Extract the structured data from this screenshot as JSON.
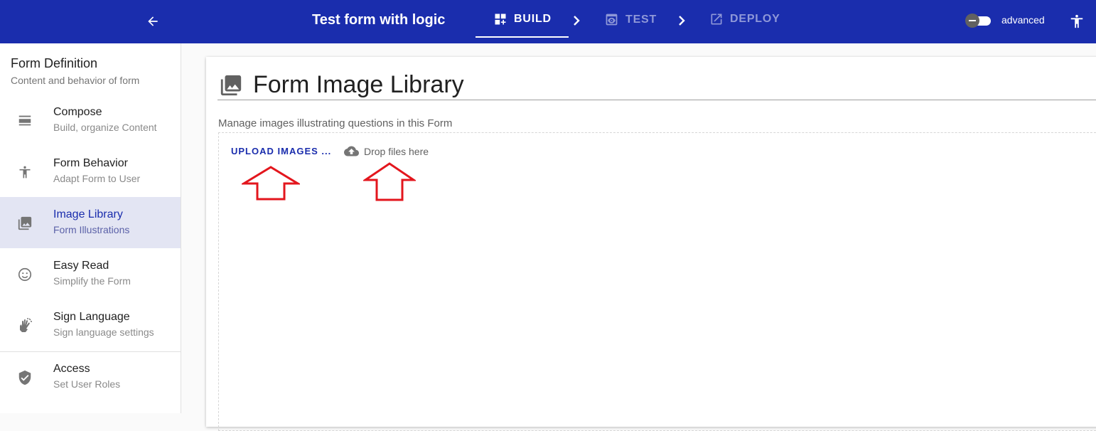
{
  "header": {
    "title": "Test form with logic",
    "steps": [
      {
        "label": "BUILD",
        "icon": "dashboard-customize-icon",
        "active": true
      },
      {
        "label": "TEST",
        "icon": "preview-eye-icon",
        "active": false
      },
      {
        "label": "DEPLOY",
        "icon": "open-in-new-icon",
        "active": false
      }
    ],
    "advanced_label": "advanced",
    "advanced_enabled": false,
    "colors": {
      "bar": "#1a2dad",
      "inactive_step": "#8f98d8"
    }
  },
  "sidebar": {
    "title": "Form Definition",
    "subtitle": "Content and behavior of form",
    "items": [
      {
        "label": "Compose",
        "sub": "Build, organize Content",
        "icon": "view-agenda-icon"
      },
      {
        "label": "Form Behavior",
        "sub": "Adapt Form to User",
        "icon": "accessibility-icon"
      },
      {
        "label": "Image Library",
        "sub": "Form Illustrations",
        "icon": "photo-library-icon",
        "active": true
      },
      {
        "label": "Easy Read",
        "sub": "Simplify the Form",
        "icon": "smiley-icon"
      },
      {
        "label": "Sign Language",
        "sub": "Sign language settings",
        "icon": "sign-language-icon"
      },
      {
        "label": "Access",
        "sub": "Set User Roles",
        "icon": "shield-check-icon"
      }
    ]
  },
  "main": {
    "title": "Form Image Library",
    "title_icon": "photo-library-icon",
    "description": "Manage images illustrating questions in this Form",
    "upload_label": "UPLOAD IMAGES ...",
    "drop_label": "Drop files here",
    "drop_icon": "cloud-upload-icon",
    "annotation_color": "#e3161d"
  }
}
